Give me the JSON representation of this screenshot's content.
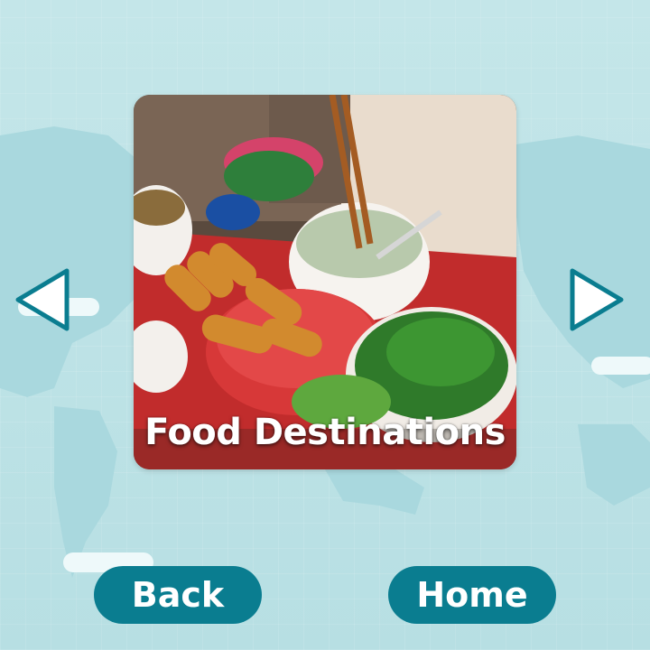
{
  "card": {
    "title": "Food Destinations",
    "image_icon": "food-photo-icon"
  },
  "navigation": {
    "prev_icon": "triangle-left-icon",
    "next_icon": "triangle-right-icon"
  },
  "buttons": {
    "back_label": "Back",
    "home_label": "Home"
  },
  "colors": {
    "button_bg": "#0a7d90",
    "arrow_outline": "#0a7d90",
    "background": "#bfe3e6"
  }
}
